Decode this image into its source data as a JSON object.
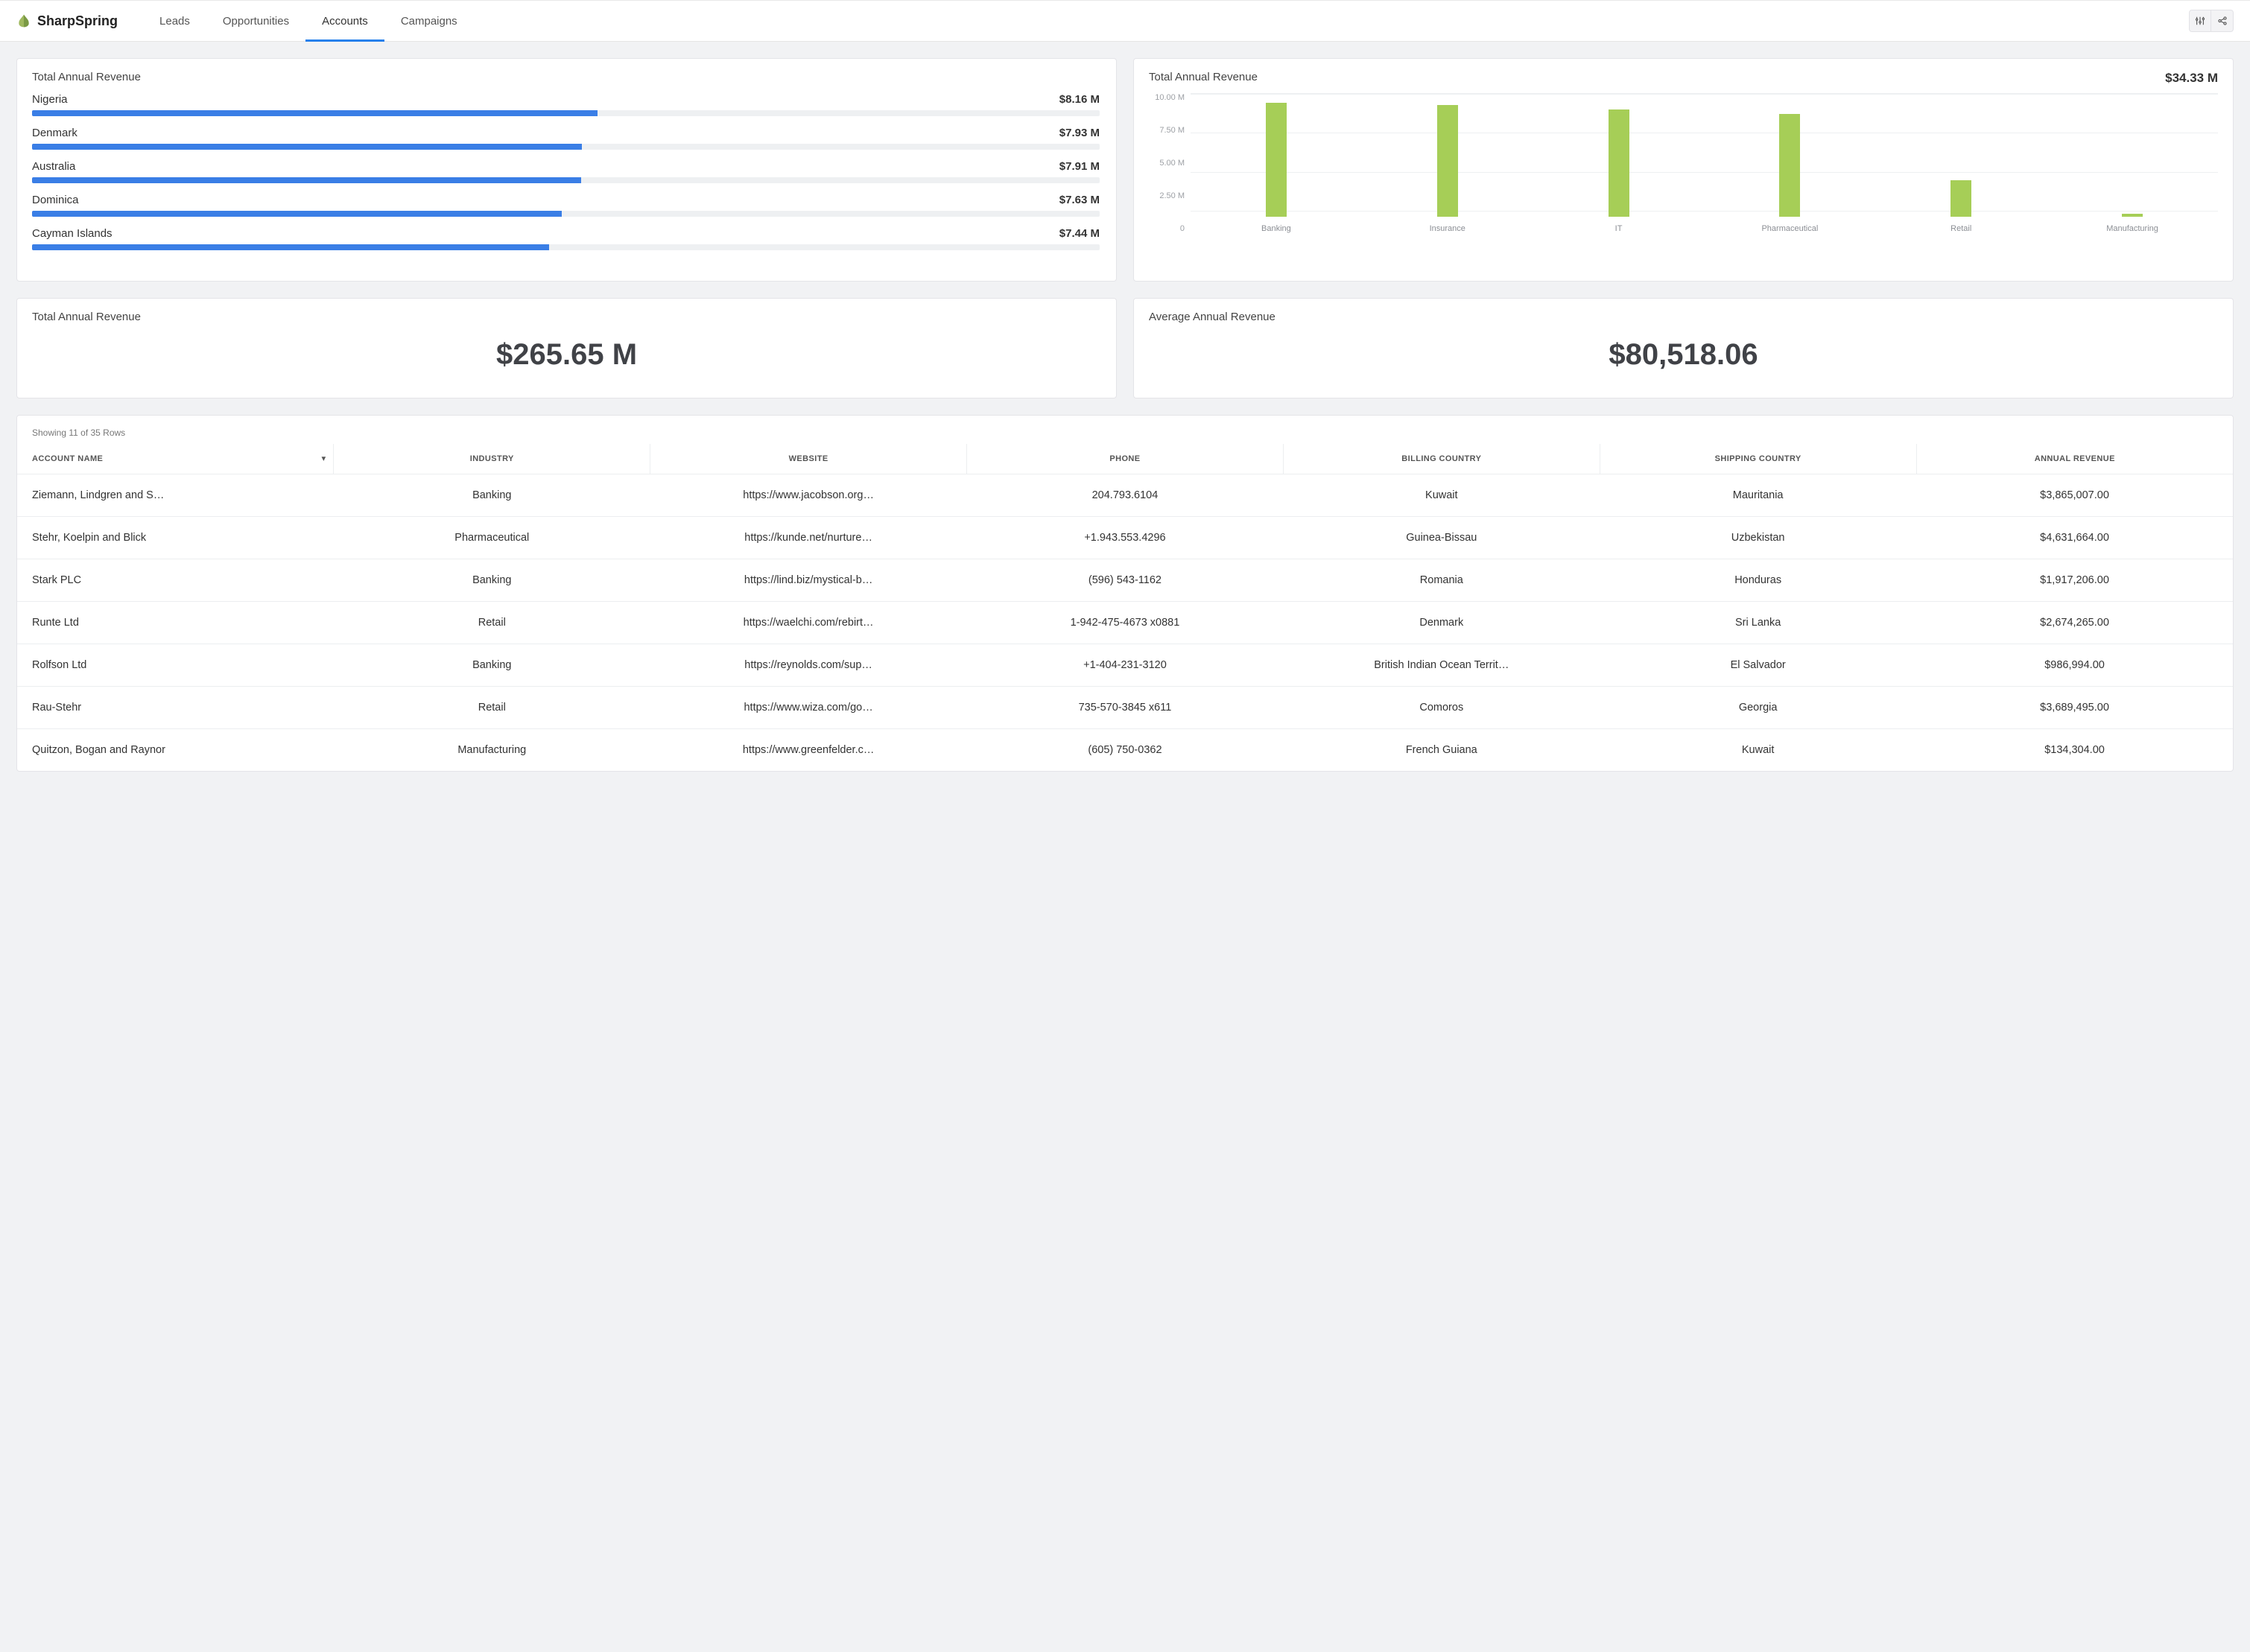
{
  "brand": "SharpSpring",
  "nav": {
    "tabs": [
      "Leads",
      "Opportunities",
      "Accounts",
      "Campaigns"
    ],
    "active": 2
  },
  "country_card": {
    "title": "Total Annual Revenue",
    "max": 10,
    "rows": [
      {
        "name": "Nigeria",
        "value_label": "$8.16 M",
        "value": 8.16
      },
      {
        "name": "Denmark",
        "value_label": "$7.93 M",
        "value": 7.93
      },
      {
        "name": "Australia",
        "value_label": "$7.91 M",
        "value": 7.91
      },
      {
        "name": "Dominica",
        "value_label": "$7.63 M",
        "value": 7.63
      },
      {
        "name": "Cayman Islands",
        "value_label": "$7.44 M",
        "value": 7.44
      }
    ]
  },
  "chart_card": {
    "title": "Total Annual Revenue",
    "total_label": "$34.33 M"
  },
  "chart_data": {
    "type": "bar",
    "title": "Total Annual Revenue",
    "categories": [
      "Banking",
      "Insurance",
      "IT",
      "Pharmaceutical",
      "Retail",
      "Manufacturing"
    ],
    "values": [
      8.2,
      8.0,
      7.7,
      7.4,
      2.6,
      0.2
    ],
    "ylim": [
      0,
      10
    ],
    "yticks": [
      "10.00 M",
      "7.50 M",
      "5.00 M",
      "2.50 M",
      "0"
    ],
    "ylabel": "",
    "xlabel": ""
  },
  "metric_total": {
    "title": "Total Annual Revenue",
    "value": "$265.65 M"
  },
  "metric_avg": {
    "title": "Average Annual Revenue",
    "value": "$80,518.06"
  },
  "table": {
    "meta": "Showing 11 of 35 Rows",
    "columns": [
      "ACCOUNT NAME",
      "INDUSTRY",
      "WEBSITE",
      "PHONE",
      "BILLING COUNTRY",
      "SHIPPING COUNTRY",
      "ANNUAL REVENUE"
    ],
    "sort_col": 0,
    "rows": [
      [
        "Ziemann, Lindgren and S…",
        "Banking",
        "https://www.jacobson.org…",
        "204.793.6104",
        "Kuwait",
        "Mauritania",
        "$3,865,007.00"
      ],
      [
        "Stehr, Koelpin and Blick",
        "Pharmaceutical",
        "https://kunde.net/nurture…",
        "+1.943.553.4296",
        "Guinea-Bissau",
        "Uzbekistan",
        "$4,631,664.00"
      ],
      [
        "Stark PLC",
        "Banking",
        "https://lind.biz/mystical-b…",
        "(596) 543-1162",
        "Romania",
        "Honduras",
        "$1,917,206.00"
      ],
      [
        "Runte Ltd",
        "Retail",
        "https://waelchi.com/rebirt…",
        "1-942-475-4673 x0881",
        "Denmark",
        "Sri Lanka",
        "$2,674,265.00"
      ],
      [
        "Rolfson Ltd",
        "Banking",
        "https://reynolds.com/sup…",
        "+1-404-231-3120",
        "British Indian Ocean Territ…",
        "El Salvador",
        "$986,994.00"
      ],
      [
        "Rau-Stehr",
        "Retail",
        "https://www.wiza.com/go…",
        "735-570-3845 x611",
        "Comoros",
        "Georgia",
        "$3,689,495.00"
      ],
      [
        "Quitzon, Bogan and Raynor",
        "Manufacturing",
        "https://www.greenfelder.c…",
        "(605) 750-0362",
        "French Guiana",
        "Kuwait",
        "$134,304.00"
      ]
    ]
  }
}
